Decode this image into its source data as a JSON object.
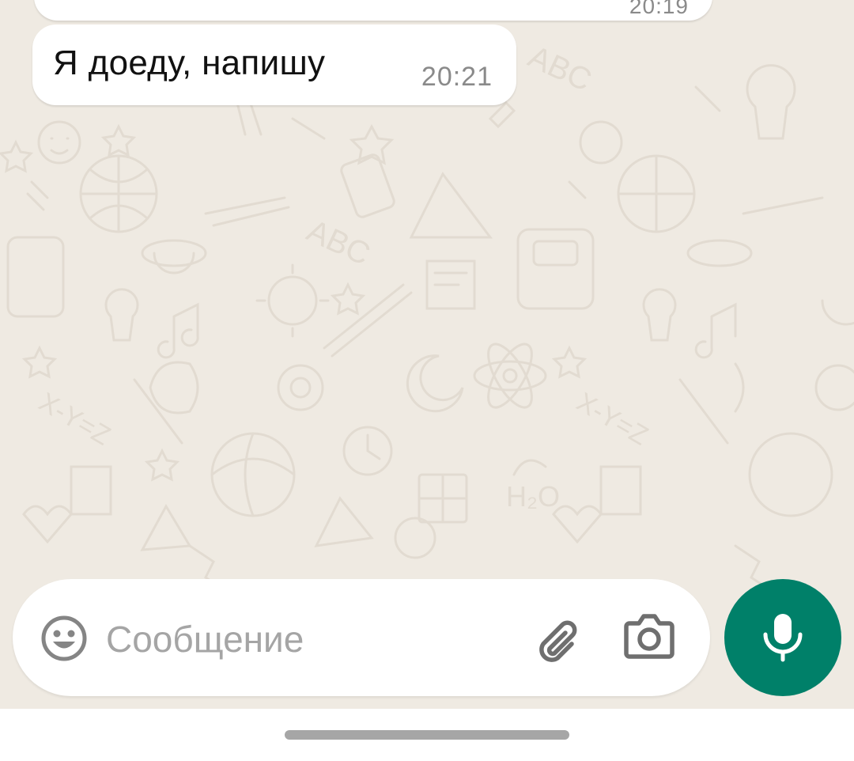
{
  "messages": [
    {
      "text": "",
      "time": "20:19",
      "partial": true
    },
    {
      "text": "Я доеду, напишу",
      "time": "20:21"
    }
  ],
  "composer": {
    "placeholder": "Сообщение",
    "emoji_icon": "emoji-icon",
    "attach_icon": "paperclip-icon",
    "camera_icon": "camera-icon"
  },
  "mic_button": {
    "icon": "microphone-icon",
    "color": "#008069"
  },
  "colors": {
    "chat_background": "#efeae2",
    "bubble": "#ffffff",
    "accent": "#008069"
  }
}
